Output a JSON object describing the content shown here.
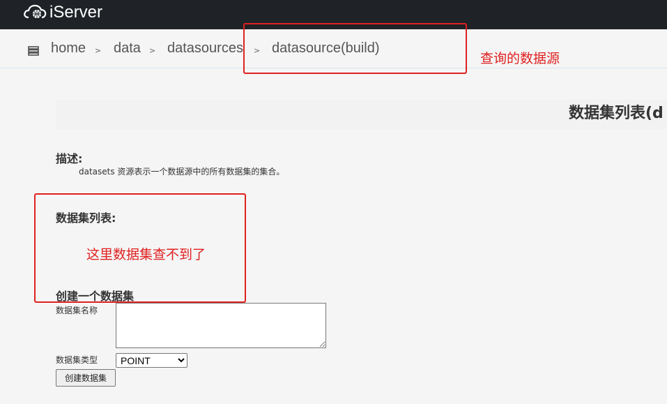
{
  "header": {
    "logo_text": "iServer",
    "logo_icon": "cloud-globe-icon",
    "bg_color": "#1f2327"
  },
  "breadcrumb": {
    "icon": "server-list-icon",
    "items": [
      {
        "label": "home"
      },
      {
        "label": "data"
      },
      {
        "label": "datasources"
      },
      {
        "label": "datasource(build)"
      }
    ],
    "separator": ">"
  },
  "annotations": {
    "color": "#e02020",
    "queried_datasource": "查询的数据源",
    "dataset_missing": "这里数据集查不到了"
  },
  "main": {
    "page_title": "数据集列表(d",
    "description_heading": "描述:",
    "description_text": "datasets 资源表示一个数据源中的所有数据集的集合。",
    "dataset_list_heading": "数据集列表:",
    "create_heading": "创建一个数据集",
    "form": {
      "name_label": "数据集名称",
      "name_value": "",
      "type_label": "数据集类型",
      "type_selected": "POINT",
      "submit_label": "创建数据集"
    }
  }
}
